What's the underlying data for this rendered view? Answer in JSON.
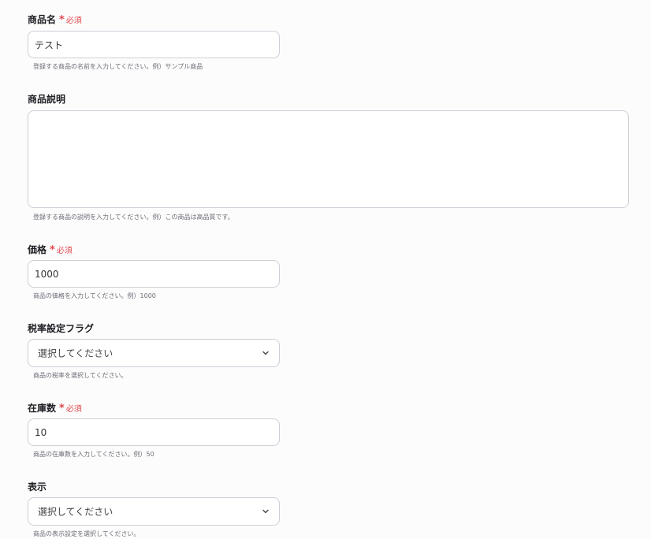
{
  "required_text": "必須",
  "required_mark": "*",
  "fields": {
    "product_name": {
      "label": "商品名",
      "value": "テスト",
      "help": "登録する商品の名前を入力してください。例）サンプル商品"
    },
    "product_description": {
      "label": "商品説明",
      "value": "",
      "help": "登録する商品の説明を入力してください。例）この商品は高品質です。"
    },
    "price": {
      "label": "価格",
      "value": "1000",
      "help": "商品の価格を入力してください。例）1000"
    },
    "tax_rate_flag": {
      "label": "税率設定フラグ",
      "value": "選択してください",
      "help": "商品の税率を選択してください。"
    },
    "stock": {
      "label": "在庫数",
      "value": "10",
      "help": "商品の在庫数を入力してください。例）50"
    },
    "display": {
      "label": "表示",
      "value": "選択してください",
      "help": "商品の表示設定を選択してください。"
    }
  }
}
